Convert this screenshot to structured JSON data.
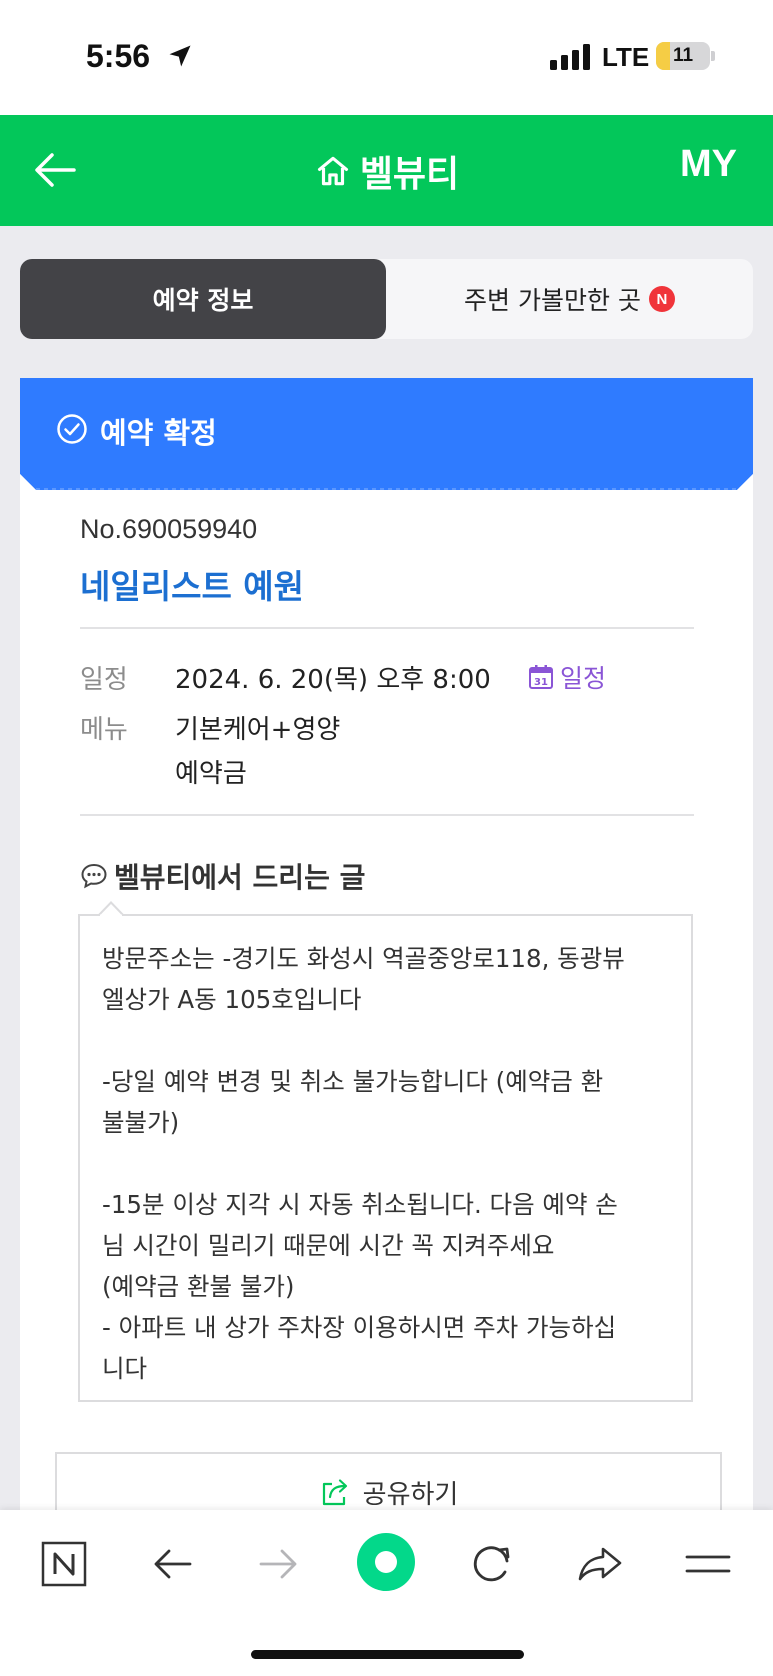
{
  "status_bar": {
    "time": "5:56",
    "network": "LTE",
    "battery": "11",
    "battery_level": 0.11
  },
  "header": {
    "title": "벨뷰티",
    "my_label": "MY"
  },
  "tabs": {
    "active_label": "예약 정보",
    "inactive_label": "주변 가볼만한 곳",
    "new_badge": "N"
  },
  "reservation": {
    "status": "예약 확정",
    "number": "No.690059940",
    "shop_name": "네일리스트 예원",
    "schedule_label": "일정",
    "schedule_value": "2024. 6. 20(목) 오후 8:00",
    "calendar_day": "31",
    "calendar_link": "일정",
    "menu_label": "메뉴",
    "menu_items": [
      "기본케어+영양",
      "예약금"
    ]
  },
  "message": {
    "title": "벨뷰티에서 드리는 글",
    "body": "방문주소는 -경기도 화성시 역골중앙로118, 동광뷰\n엘상가 A동 105호입니다\n\n-당일 예약 변경 및 취소 불가능합니다 (예약금 환\n불불가)\n\n-15분 이상 지각 시 자동 취소됩니다. 다음 예약 손\n님 시간이 밀리기 때문에 시간 꼭 지켜주세요\n(예약금 환불 불가)\n- 아파트 내 상가 주차장 이용하시면 주차 가능하십\n니다"
  },
  "share": {
    "label": "공유하기"
  },
  "colors": {
    "brand_green": "#03c75a",
    "status_blue": "#2f7bff",
    "shop_blue": "#1c6fd1",
    "calendar_purple": "#8a55d6"
  },
  "toolbar_icons": [
    "naver-n-icon",
    "back-arrow-icon",
    "forward-arrow-icon",
    "green-dot-icon",
    "refresh-icon",
    "share-arrow-icon",
    "menu-icon"
  ]
}
